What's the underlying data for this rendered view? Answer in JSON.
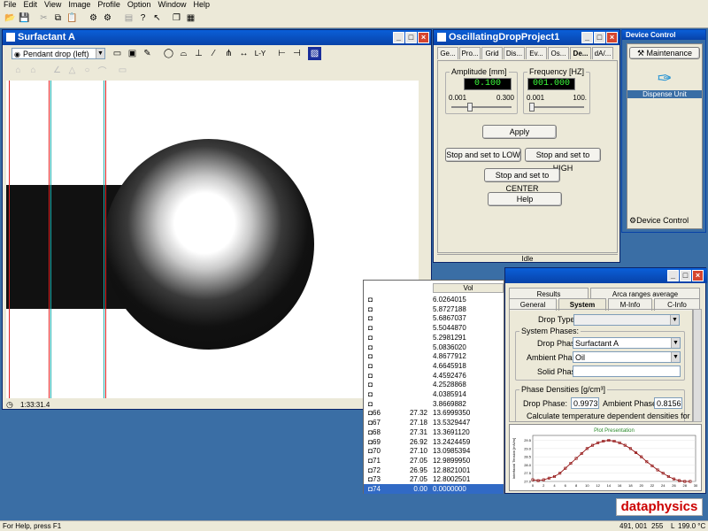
{
  "menu": [
    "File",
    "Edit",
    "View",
    "Image",
    "Profile",
    "Option",
    "Window",
    "Help"
  ],
  "main_window": {
    "title": "Surfactant A",
    "mode_select": "Pendant drop (left)",
    "timestamp": "1:33:31.4",
    "scale_labels": [
      "L-Y"
    ]
  },
  "project_window": {
    "title": "OscillatingDropProject1",
    "tabs": [
      "Ge...",
      "Pro...",
      "Grid",
      "Dis...",
      "Ev...",
      "Os...",
      "De...",
      "dA/..."
    ],
    "amplitude": {
      "label": "Amplitude [mm]",
      "value": "0.100",
      "min": "0.001",
      "max": "0.300"
    },
    "frequency": {
      "label": "Frequency [HZ]",
      "value": "001.000",
      "min": "0.001",
      "max": "100."
    },
    "buttons": {
      "apply": "Apply",
      "low": "Stop and set to LOW",
      "high": "Stop and set to HIGH",
      "center": "Stop and set to CENTER",
      "help": "Help"
    },
    "status": "Idle"
  },
  "device_window": {
    "title": "Device Control",
    "maintenance": "Maintenance",
    "dispense_unit": "Dispense Unit",
    "footer": "Device Control"
  },
  "data_table": {
    "header": "Vol",
    "rows": [
      {
        "id": "",
        "t": "",
        "v": "6.0264015"
      },
      {
        "id": "",
        "t": "",
        "v": "5.8727188"
      },
      {
        "id": "",
        "t": "",
        "v": "5.6867037"
      },
      {
        "id": "",
        "t": "",
        "v": "5.5044870"
      },
      {
        "id": "",
        "t": "",
        "v": "5.2981291"
      },
      {
        "id": "",
        "t": "",
        "v": "5.0836020"
      },
      {
        "id": "",
        "t": "",
        "v": "4.8677912"
      },
      {
        "id": "",
        "t": "",
        "v": "4.6645918"
      },
      {
        "id": "",
        "t": "",
        "v": "4.4592476"
      },
      {
        "id": "",
        "t": "",
        "v": "4.2528868"
      },
      {
        "id": "",
        "t": "",
        "v": "4.0385914"
      },
      {
        "id": "",
        "t": "",
        "v": "3.8669882"
      },
      {
        "id": "66",
        "t": "27.32",
        "v": "13.6999350"
      },
      {
        "id": "67",
        "t": "27.18",
        "v": "13.5329447"
      },
      {
        "id": "68",
        "t": "27.31",
        "v": "13.3691120"
      },
      {
        "id": "69",
        "t": "26.92",
        "v": "13.2424459"
      },
      {
        "id": "70",
        "t": "27.10",
        "v": "13.0985394"
      },
      {
        "id": "71",
        "t": "27.05",
        "v": "12.9899950"
      },
      {
        "id": "72",
        "t": "26.95",
        "v": "12.8821001"
      },
      {
        "id": "73",
        "t": "27.05",
        "v": "12.8002501"
      },
      {
        "id": "74",
        "t": "0.00",
        "v": "0.0000000"
      }
    ]
  },
  "props_window": {
    "tabs_top": [
      "Results",
      "Arca ranges average"
    ],
    "tabs_bottom": [
      "General",
      "System",
      "M-Info",
      "C-Info"
    ],
    "drop_type_label": "Drop Type:",
    "system_phases_label": "System Phases:",
    "drop_phase_label": "Drop Phase:",
    "drop_phase": "Surfactant A",
    "ambient_phase_label": "Ambient Phase:",
    "ambient_phase": "Oil",
    "solid_phase_label": "Solid Phase:",
    "densities_label": "Phase Densities [g/cm³]",
    "drop_density_label": "Drop Phase:",
    "drop_density": "0.9973",
    "ambient_density_label": "Ambient Phase:",
    "ambient_density": "0.8156",
    "calc_text": "Calculate temperature dependent densities for"
  },
  "chart_data": {
    "type": "line",
    "title": "Plot Presentation",
    "ylabel": "Interfacial Tension [mN/m]",
    "x_ticks": [
      "0",
      "2",
      "4",
      "6",
      "8",
      "10",
      "12",
      "14",
      "16",
      "18",
      "20",
      "22",
      "24",
      "26",
      "28",
      "30"
    ],
    "y_ticks": [
      "27.0",
      "27.5",
      "28.0",
      "28.5",
      "29.0",
      "29.5"
    ],
    "ylim": [
      27.0,
      29.8
    ],
    "xlim": [
      0,
      30
    ],
    "series": [
      {
        "x": [
          0,
          1,
          2,
          3,
          4,
          5,
          6,
          7,
          8,
          9,
          10,
          11,
          12,
          13,
          14,
          15,
          16,
          17,
          18,
          19,
          20,
          21,
          22,
          23,
          24,
          25,
          26,
          27,
          28,
          29
        ],
        "values": [
          27.1,
          27.05,
          27.1,
          27.2,
          27.3,
          27.5,
          27.8,
          28.1,
          28.4,
          28.7,
          29.0,
          29.2,
          29.35,
          29.45,
          29.5,
          29.45,
          29.35,
          29.2,
          29.0,
          28.75,
          28.5,
          28.2,
          27.95,
          27.7,
          27.5,
          27.3,
          27.15,
          27.05,
          27.0,
          27.0
        ]
      }
    ]
  },
  "brand": "dataphysics",
  "status_bar": {
    "help": "For Help, press F1",
    "coords": "491, 001",
    "val": "255",
    "mode": "L",
    "temp": "199.0 °C"
  }
}
